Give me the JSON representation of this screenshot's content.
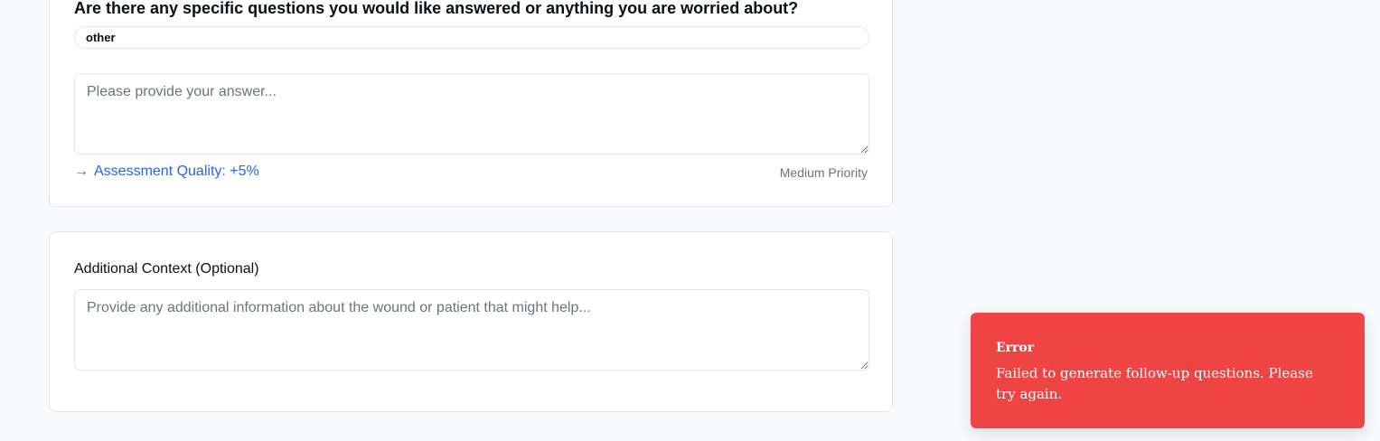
{
  "question_card": {
    "title": "Are there any specific questions you would like answered or anything you are worried about?",
    "selected_option": "other",
    "answer_placeholder": "Please provide your answer...",
    "answer_value": "",
    "quality_arrow": "→",
    "quality_text": "Assessment Quality: +5%",
    "priority": "Medium Priority"
  },
  "context_card": {
    "label": "Additional Context (Optional)",
    "placeholder": "Provide any additional information about the wound or patient that might help...",
    "value": ""
  },
  "toast": {
    "title": "Error",
    "message": "Failed to generate follow-up questions. Please try again.",
    "color": "#ef4444"
  },
  "colors": {
    "accent": "#2563eb",
    "background": "#f8f9fb",
    "card": "#ffffff",
    "border": "#e5e7eb",
    "muted_text": "#6b7280"
  }
}
